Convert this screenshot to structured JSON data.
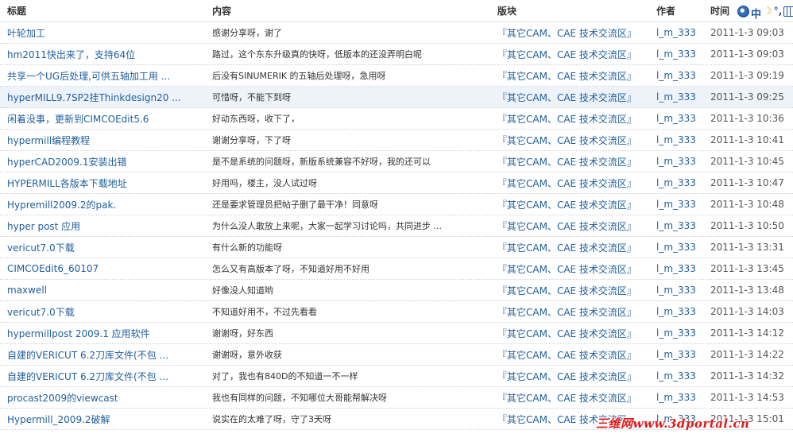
{
  "header": {
    "title": "标题",
    "content": "内容",
    "forum": "版块",
    "author": "作者",
    "time": "时间"
  },
  "toolbar_icons": [
    "globe-icon",
    "chinese-input-icon",
    "moon-icon",
    "punctuation-dot-icon",
    "keyboard-icon"
  ],
  "toolbar_text": "中",
  "rows": [
    {
      "title": "叶轮加工",
      "content": "感谢分享呀，谢了",
      "forum": "『其它CAM、CAE 技术交流区』",
      "author": "l_m_333",
      "time": "2011-1-3 09:03"
    },
    {
      "title": "hm2011快出来了，支持64位",
      "content": "路过，这个东东升级真的快呀，低版本的还没弄明白呢",
      "forum": "『其它CAM、CAE 技术交流区』",
      "author": "l_m_333",
      "time": "2011-1-3 09:03"
    },
    {
      "title": "共享一个UG后处理,可供五轴加工用 ...",
      "content": "后没有SINUMERIK 的五轴后处理呀，急用呀",
      "forum": "『其它CAM、CAE 技术交流区』",
      "author": "l_m_333",
      "time": "2011-1-3 09:19"
    },
    {
      "title": "hyperMILL9.7SP2挂Thinkdesign20 ...",
      "content": "可惜呀，不能下到呀",
      "forum": "『其它CAM、CAE 技术交流区』",
      "author": "l_m_333",
      "time": "2011-1-3 09:25"
    },
    {
      "title": "闲着没事，更新到CIMCOEdit5.6",
      "content": "好动东西呀，收下了，",
      "forum": "『其它CAM、CAE 技术交流区』",
      "author": "l_m_333",
      "time": "2011-1-3 10:36"
    },
    {
      "title": "hypermill编程教程",
      "content": "谢谢分享呀，下了呀",
      "forum": "『其它CAM、CAE 技术交流区』",
      "author": "l_m_333",
      "time": "2011-1-3 10:41"
    },
    {
      "title": "hyperCAD2009.1安装出错",
      "content": "是不是系统的问题呀，新版系统兼容不好呀，我的还可以",
      "forum": "『其它CAM、CAE 技术交流区』",
      "author": "l_m_333",
      "time": "2011-1-3 10:45"
    },
    {
      "title": "HYPERMILL各版本下载地址",
      "content": "好用吗，楼主，没人试过呀",
      "forum": "『其它CAM、CAE 技术交流区』",
      "author": "l_m_333",
      "time": "2011-1-3 10:47"
    },
    {
      "title": "Hypremill2009.2的pak.",
      "content": "还是要求管理员把帖子删了最干净！同意呀",
      "forum": "『其它CAM、CAE 技术交流区』",
      "author": "l_m_333",
      "time": "2011-1-3 10:48"
    },
    {
      "title": "hyper post 应用",
      "content": "为什么没人敢放上来呢，大家一起学习讨论吗，共同进步 ...",
      "forum": "『其它CAM、CAE 技术交流区』",
      "author": "l_m_333",
      "time": "2011-1-3 10:50"
    },
    {
      "title": "vericut7.0下载",
      "content": "有什么新的功能呀",
      "forum": "『其它CAM、CAE 技术交流区』",
      "author": "l_m_333",
      "time": "2011-1-3 13:31"
    },
    {
      "title": "CIMCOEdit6_60107",
      "content": "怎么又有高版本了呀，不知道好用不好用",
      "forum": "『其它CAM、CAE 技术交流区』",
      "author": "l_m_333",
      "time": "2011-1-3 13:45"
    },
    {
      "title": "maxwell",
      "content": "好像没人知道哟",
      "forum": "『其它CAM、CAE 技术交流区』",
      "author": "l_m_333",
      "time": "2011-1-3 13:48"
    },
    {
      "title": "vericut7.0下载",
      "content": "不知道好用不，不过先看看",
      "forum": "『其它CAM、CAE 技术交流区』",
      "author": "l_m_333",
      "time": "2011-1-3 14:03"
    },
    {
      "title": "hypermillpost 2009.1 应用软件",
      "content": "谢谢呀，好东西",
      "forum": "『其它CAM、CAE 技术交流区』",
      "author": "l_m_333",
      "time": "2011-1-3 14:12"
    },
    {
      "title": "自建的VERICUT 6.2刀库文件(不包 ...",
      "content": "谢谢呀，意外收获",
      "forum": "『其它CAM、CAE 技术交流区』",
      "author": "l_m_333",
      "time": "2011-1-3 14:22"
    },
    {
      "title": "自建的VERICUT 6.2刀库文件(不包 ...",
      "content": "对了，我也有840D的不知道一不一样",
      "forum": "『其它CAM、CAE 技术交流区』",
      "author": "l_m_333",
      "time": "2011-1-3 14:32"
    },
    {
      "title": "procast2009的viewcast",
      "content": "我也有同样的问题，不知哪位大哥能帮解决呀",
      "forum": "『其它CAM、CAE 技术交流区』",
      "author": "l_m_333",
      "time": "2011-1-3 14:53"
    },
    {
      "title": "Hypermill_2009.2破解",
      "content": "说实在的太难了呀，守了3天呀",
      "forum": "『其它CAM、CAE 技术交流区』",
      "author": "l_m_333",
      "time": "2011-1-3 15:01"
    }
  ],
  "highlight_row": 3,
  "watermark": "三维网www.3dportal.cn"
}
